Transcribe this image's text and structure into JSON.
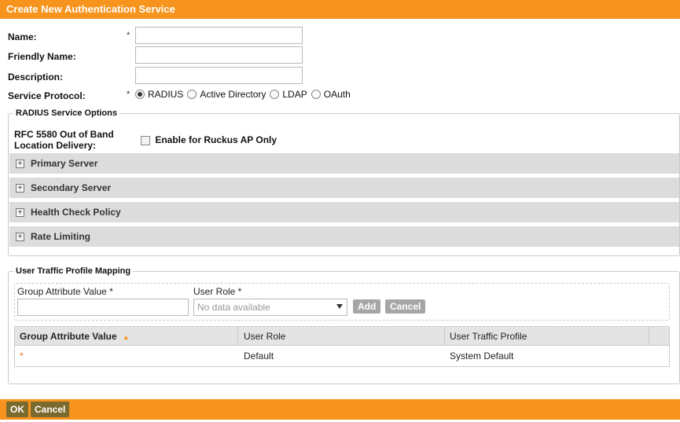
{
  "dialog": {
    "title": "Create New Authentication Service"
  },
  "form": {
    "name_label": "Name:",
    "friendly_name_label": "Friendly Name:",
    "description_label": "Description:",
    "service_protocol_label": "Service Protocol:",
    "required_mark": "*",
    "name_value": "",
    "friendly_name_value": "",
    "description_value": "",
    "protocols": [
      {
        "label": "RADIUS",
        "selected": true
      },
      {
        "label": "Active Directory",
        "selected": false
      },
      {
        "label": "LDAP",
        "selected": false
      },
      {
        "label": "OAuth",
        "selected": false
      }
    ]
  },
  "radius_options": {
    "legend": "RADIUS Service Options",
    "rfc_label_line1": "RFC 5580 Out of Band",
    "rfc_label_line2": "Location Delivery:",
    "enable_label": "Enable for Ruckus AP Only",
    "enable_checked": false,
    "sections": [
      "Primary Server",
      "Secondary Server",
      "Health Check Policy",
      "Rate Limiting"
    ]
  },
  "mapping": {
    "legend": "User Traffic Profile Mapping",
    "group_attr_label": "Group Attribute Value *",
    "user_role_label": "User Role *",
    "group_attr_value": "",
    "user_role_selected": "No data available",
    "add_button": "Add",
    "cancel_button": "Cancel",
    "columns": [
      "Group Attribute Value",
      "User Role",
      "User Traffic Profile"
    ],
    "sort_indicator": "▲",
    "rows": [
      {
        "group_attribute": "*",
        "user_role": "Default",
        "user_traffic_profile": "System Default"
      }
    ]
  },
  "footer": {
    "ok_label": "OK",
    "cancel_label": "Cancel"
  },
  "colors": {
    "accent": "#f7941d",
    "footer_button": "#7a6a2e",
    "section_bg": "#dcdcdc"
  }
}
